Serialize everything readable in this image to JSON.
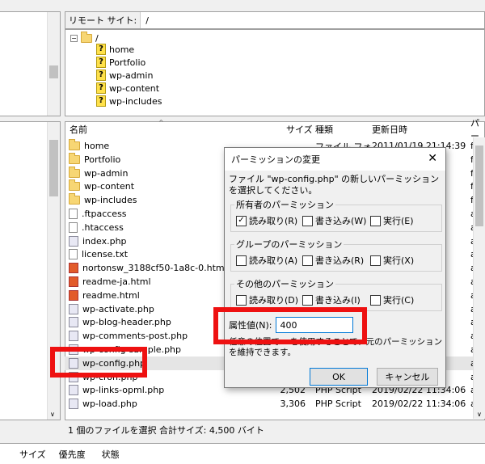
{
  "remote": {
    "label": "リモート サイト:",
    "path": "/"
  },
  "tree": {
    "root": "/",
    "items": [
      "home",
      "Portfolio",
      "wp-admin",
      "wp-content",
      "wp-includes"
    ]
  },
  "columns": {
    "name": "名前",
    "size": "サイズ",
    "type": "種類",
    "date": "更新日時",
    "perm": "パー"
  },
  "files": [
    {
      "name": "home",
      "icon": "folder",
      "size": "",
      "type": "ファイル フォ...",
      "date": "2011/01/19 21:14:39",
      "perm": "flcd"
    },
    {
      "name": "Portfolio",
      "icon": "folder",
      "size": "",
      "type": "",
      "date": "",
      "perm": "flcd"
    },
    {
      "name": "wp-admin",
      "icon": "folder",
      "size": "",
      "type": "",
      "date": "",
      "perm": "flcd"
    },
    {
      "name": "wp-content",
      "icon": "folder",
      "size": "",
      "type": "",
      "date": "",
      "perm": "flcd"
    },
    {
      "name": "wp-includes",
      "icon": "folder",
      "size": "",
      "type": "",
      "date": "",
      "perm": "flcd"
    },
    {
      "name": ".ftpaccess",
      "icon": "file",
      "size": "",
      "type": "",
      "date": "",
      "perm": "adfr"
    },
    {
      "name": ".htaccess",
      "icon": "file",
      "size": "",
      "type": "",
      "date": "",
      "perm": "adfr"
    },
    {
      "name": "index.php",
      "icon": "php",
      "size": "",
      "type": "",
      "date": "",
      "perm": "adfr"
    },
    {
      "name": "license.txt",
      "icon": "file",
      "size": "",
      "type": "",
      "date": "",
      "perm": "adfr"
    },
    {
      "name": "nortonsw_3188cf50-1a8c-0.html",
      "icon": "html",
      "size": "",
      "type": "",
      "date": "",
      "perm": "adfr"
    },
    {
      "name": "readme-ja.html",
      "icon": "html",
      "size": "",
      "type": "",
      "date": "",
      "perm": "adfr"
    },
    {
      "name": "readme.html",
      "icon": "html",
      "size": "",
      "type": "",
      "date": "",
      "perm": "adfr"
    },
    {
      "name": "wp-activate.php",
      "icon": "php",
      "size": "",
      "type": "",
      "date": "",
      "perm": "adfr"
    },
    {
      "name": "wp-blog-header.php",
      "icon": "php",
      "size": "",
      "type": "",
      "date": "",
      "perm": "adfr"
    },
    {
      "name": "wp-comments-post.php",
      "icon": "php",
      "size": "",
      "type": "",
      "date": "",
      "perm": "adfr"
    },
    {
      "name": "wp-config-sample.php",
      "icon": "php",
      "size": "",
      "type": "",
      "date": "",
      "perm": "adfr"
    },
    {
      "name": "wp-config.php",
      "icon": "php",
      "size": "",
      "type": "",
      "date": "",
      "perm": "adfr"
    },
    {
      "name": "wp-cron.php",
      "icon": "php",
      "size": "",
      "type": "",
      "date": "",
      "perm": "adfr"
    },
    {
      "name": "wp-links-opml.php",
      "icon": "php",
      "size": "2,502",
      "type": "PHP Script",
      "date": "2019/02/22 11:34:06",
      "perm": "adfr"
    },
    {
      "name": "wp-load.php",
      "icon": "php",
      "size": "3,306",
      "type": "PHP Script",
      "date": "2019/02/22 11:34:06",
      "perm": "adfr"
    }
  ],
  "status": "1 個のファイルを選択 合計サイズ: 4,500 バイト",
  "queue_tabs": [
    "サイズ",
    "優先度",
    "状態"
  ],
  "dialog": {
    "title": "パーミッションの変更",
    "close": "✕",
    "description": "ファイル \"wp-config.php\" の新しいパーミッションを選択してください。",
    "groups": [
      {
        "label": "所有者のパーミッション",
        "read": "読み取り(R)",
        "write": "書き込み(W)",
        "exec": "実行(E)",
        "checked": [
          true,
          false,
          false
        ]
      },
      {
        "label": "グループのパーミッション",
        "read": "読み取り(A)",
        "write": "書き込み(R)",
        "exec": "実行(X)",
        "checked": [
          false,
          false,
          false
        ]
      },
      {
        "label": "その他のパーミッション",
        "read": "読み取り(D)",
        "write": "書き込み(I)",
        "exec": "実行(C)",
        "checked": [
          false,
          false,
          false
        ]
      }
    ],
    "attr_label": "属性値(N):",
    "attr_value": "400",
    "note": "任意の位置で x を使用することで、元のパーミッションを維持できます。",
    "ok": "OK",
    "cancel": "キャンセル"
  },
  "colors": {
    "highlight": "#ee1111",
    "accent": "#0078d7"
  }
}
